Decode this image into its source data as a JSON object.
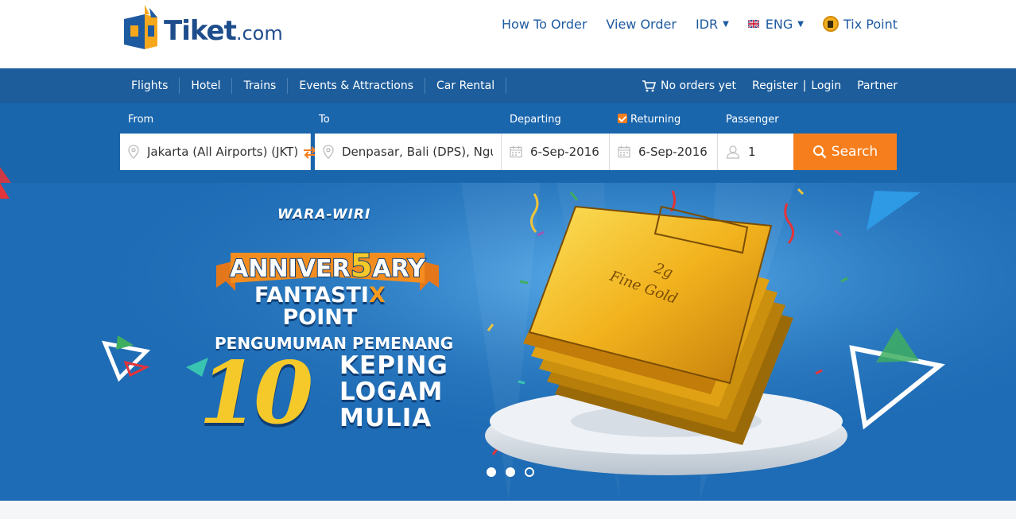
{
  "brand": {
    "logo_text": "Tiket",
    "logo_suffix": ".com",
    "brand_color": "#1e4d8c"
  },
  "top_nav": {
    "how_to_order": "How To Order",
    "view_order": "View Order",
    "currency": "IDR",
    "language": "ENG",
    "tix_point": "Tix Point"
  },
  "nav": {
    "items": [
      {
        "label": "Flights"
      },
      {
        "label": "Hotel"
      },
      {
        "label": "Trains"
      },
      {
        "label": "Events & Attractions"
      },
      {
        "label": "Car Rental"
      }
    ],
    "cart": "No orders yet",
    "register": "Register",
    "separator": "|",
    "login": "Login",
    "partner": "Partner"
  },
  "search": {
    "from_label": "From",
    "to_label": "To",
    "departing_label": "Departing",
    "returning_label": "Returning",
    "returning_checked": true,
    "passenger_label": "Passenger",
    "from_value": "Jakarta (All Airports) (JKT), Jakarta",
    "to_value": "Denpasar, Bali (DPS), Ngurah Rai",
    "departing_value": "6-Sep-2016",
    "returning_value": "6-Sep-2016",
    "passenger_value": "1",
    "search_button": "Search",
    "accent": "#f77e1c"
  },
  "banner": {
    "line1": "WARA-WIRI",
    "anniv_pre": "ANNIVER",
    "anniv_num": "5",
    "anniv_post": "ARY",
    "fantastix_a": "FANTAS",
    "fantastix_t": "TI",
    "fantastix_x": "X",
    "point": "POINT",
    "announce": "PENGUMUMAN PEMENANG",
    "number": "10",
    "word1": "KEPING",
    "word2": "LOGAM",
    "word3": "MULIA",
    "gold_text1": "2g",
    "gold_text2": "Fine Gold",
    "slides": [
      {
        "active": true
      },
      {
        "active": true
      },
      {
        "active": false
      }
    ]
  }
}
